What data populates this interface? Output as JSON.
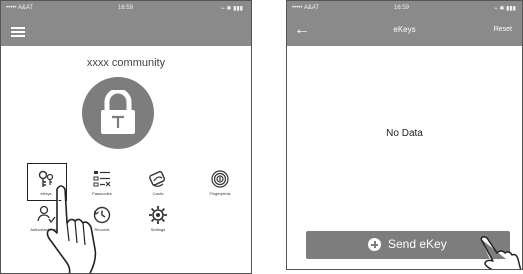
{
  "left_screen": {
    "status": {
      "carrier": "••••• A&AT",
      "time": "16:59",
      "right": "⌁ ✱ ▮▮▮"
    },
    "community_title": "xxxx community",
    "features": [
      {
        "label": "eKeys",
        "icon": "key-icon"
      },
      {
        "label": "Passcodes",
        "icon": "passcode-icon"
      },
      {
        "label": "Cards",
        "icon": "card-icon"
      },
      {
        "label": "Fingerprints",
        "icon": "fingerprint-icon"
      },
      {
        "label": "Authorized Admin",
        "icon": "admin-icon"
      },
      {
        "label": "Records",
        "icon": "records-icon"
      },
      {
        "label": "Settings",
        "icon": "settings-icon"
      }
    ]
  },
  "right_screen": {
    "status": {
      "carrier": "••••• A&AT",
      "time": "16:59",
      "right": "⌁ ✱ ▮▮▮"
    },
    "title": "eKeys",
    "reset_label": "Reset",
    "empty_text": "No Data",
    "send_button_label": "Send eKey"
  },
  "colors": {
    "header": "#8a8a8a",
    "accent": "#7d7d7d"
  }
}
